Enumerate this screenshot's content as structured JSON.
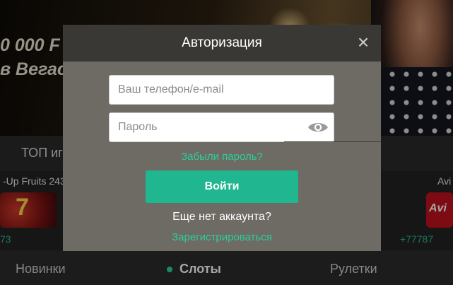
{
  "background": {
    "banner": {
      "line1": "0 000 F",
      "line2": "в Вегас"
    },
    "topbar_label": "ТОП иг",
    "games": {
      "left_title": "-Up Fruits 243",
      "left_thumb_text": "7",
      "left_amount": "73",
      "right_title": "Avi",
      "right_thumb_text": "Avi",
      "right_amount": "+77787"
    },
    "bottom_nav": {
      "new": "Новинки",
      "slots": "Слоты",
      "roulette": "Рулетки"
    }
  },
  "modal": {
    "title": "Авторизация",
    "close_icon": "×",
    "login_placeholder": "Ваш телефон/e-mail",
    "login_value": "",
    "password_placeholder": "Пароль",
    "password_value": "",
    "forgot_label": "Забыли пароль?",
    "login_button": "Войти",
    "no_account_text": "Еще нет аккаунта?",
    "register_label": "Зарегистрироваться"
  },
  "colors": {
    "accent": "#20b68f",
    "link": "#2bcf9c",
    "modal_header": "#3a3835",
    "modal_body": "#6e6a64"
  },
  "icons": {
    "close": "close-icon",
    "password_visibility": "eye-icon"
  }
}
